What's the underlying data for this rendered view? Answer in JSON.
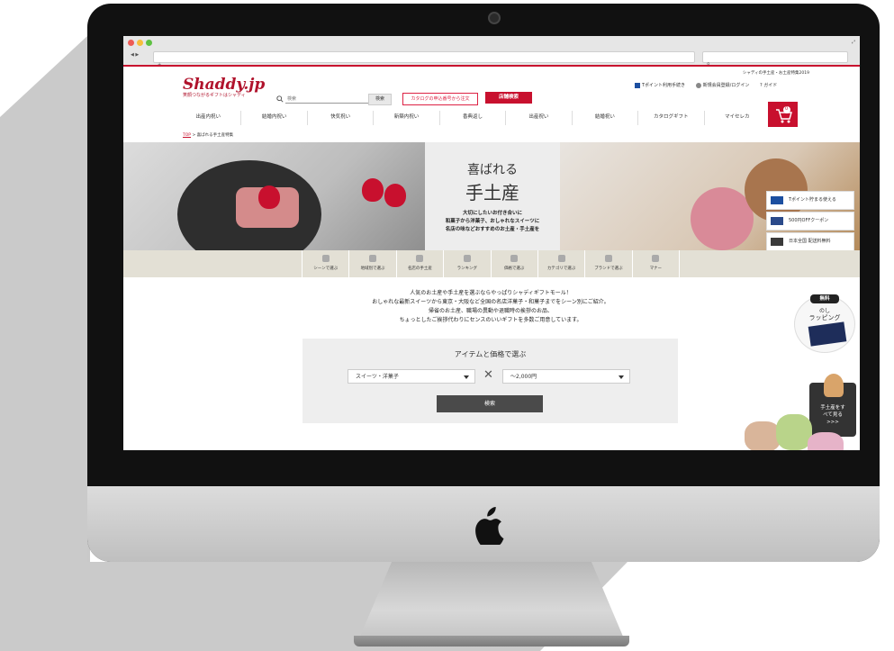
{
  "browser": {
    "url_placeholder": "+",
    "search_placeholder": ""
  },
  "site": {
    "top_note": "シャディの手土産・お土産特集2019",
    "logo": "Shaddy.jp",
    "tagline": "笑顔つながるギフトはシャディ",
    "search_placeholder": "検索",
    "search_button": "検索",
    "catalog_button": "カタログの申込番号から注文",
    "store_button": "店舗検索",
    "top_links": [
      "Tポイント利用手続き",
      "新規会員登録/ログイン",
      "ガイド"
    ],
    "nav": [
      "出産内祝い",
      "結婚内祝い",
      "快気祝い",
      "新築内祝い",
      "香典返し",
      "出産祝い",
      "結婚祝い",
      "カタログギフト",
      "マイセレカ"
    ],
    "cart_count": "0"
  },
  "breadcrumb": {
    "top": "TOP",
    "sep": ">",
    "current": "喜ばれる手土産特集"
  },
  "hero": {
    "title_line1": "喜ばれる",
    "title_line2": "手土産",
    "desc": [
      "大切にしたいお付き合いに",
      "和菓子から洋菓子、おしゃれなスイーツに",
      "名店の味などおすすめのお土産・手土産を"
    ],
    "promos": [
      "Tポイント貯まる使える",
      "500円OFFクーポン",
      "日本全国 配送料無料"
    ]
  },
  "categories": [
    "シーンで選ぶ",
    "地域別で選ぶ",
    "名店の手土産",
    "ランキング",
    "価格で選ぶ",
    "カテゴリで選ぶ",
    "ブランドで選ぶ",
    "マナー"
  ],
  "intro": [
    "人気のお土産や手土産を選ぶならやっぱりシャディギフトモール！",
    "おしゃれな最新スイーツから東京・大阪など全国の名店洋菓子・和菓子までをシーン別にご紹介。",
    "帰省のお土産、職場の異動や退職時の挨拶のお品、",
    "ちょっとしたご挨拶代わりにセンスのいいギフトを多数ご用意しています。"
  ],
  "selector": {
    "title": "アイテムと価格で選ぶ",
    "item_value": "スイーツ・洋菓子",
    "times": "✕",
    "price_value": "～2,000円",
    "button": "検索"
  },
  "side": {
    "free": "無料",
    "noshi": "のし",
    "wrapping": "ラッピング",
    "all_lines": [
      "手土産をす",
      "べて見る",
      ">>>"
    ]
  },
  "colors": {
    "brand_red": "#c8102e",
    "category_bar": "#e3e0d5",
    "button_dark": "#4a4a4a"
  }
}
